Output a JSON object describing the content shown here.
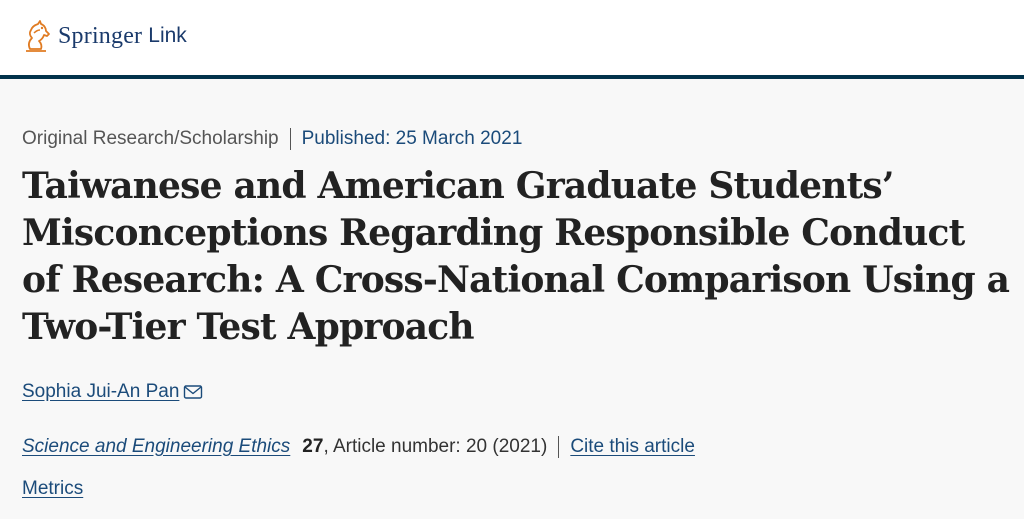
{
  "header": {
    "logo_brand": "Springer",
    "logo_product": "Link",
    "logo_icon": "springer-horse-icon",
    "rule_color": "#01324b"
  },
  "article": {
    "type": "Original Research/Scholarship",
    "published": "Published: 25 March 2021",
    "title": "Taiwanese and American Graduate Students’ Misconceptions Regarding Responsible Conduct of Research: A Cross-National Comparison Using a Two-Tier Test Approach",
    "author": "Sophia Jui-An Pan",
    "author_icon": "mail-icon",
    "journal": "Science and Engineering Ethics",
    "volume": "27",
    "article_number": ", Article number: 20 (2021)",
    "cite_label": "Cite this article",
    "metrics_label": "Metrics"
  },
  "colors": {
    "link": "#1b4b7a",
    "title": "#222222",
    "background": "#f8f8f8"
  }
}
